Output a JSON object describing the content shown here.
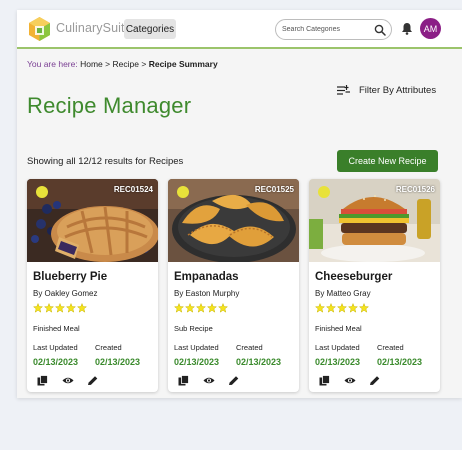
{
  "header": {
    "brand": "CulinarySuite",
    "nav_label": "Categories",
    "search_placeholder": "Search Categories",
    "avatar_initials": "AM"
  },
  "breadcrumb": {
    "prefix": "You are here:",
    "items": [
      "Home",
      "Recipe"
    ],
    "separator": ">",
    "current": "Recipe Summary"
  },
  "toolbar": {
    "filter_label": "Filter By Attributes",
    "create_label": "Create New Recipe"
  },
  "page": {
    "title": "Recipe Manager",
    "results_text": "Showing all 12/12 results for Recipes"
  },
  "labels": {
    "last_updated": "Last Updated",
    "created": "Created"
  },
  "colors": {
    "brand_green": "#3f8a2e",
    "button_green": "#3a7f2a",
    "date_green": "#3a8a2c",
    "avatar_bg": "#8b1f86",
    "star_yellow": "#f5e31e",
    "status_dot": "#e8e23a",
    "breadcrumb_prefix": "#7a3f93"
  },
  "recipes": [
    {
      "code": "REC01524",
      "title": "Blueberry Pie",
      "author": "By Oakley Gomez",
      "rating": 5,
      "type": "Finished Meal",
      "last_updated": "02/13/2023",
      "created": "02/13/2023",
      "image": "blueberry-pie-photo"
    },
    {
      "code": "REC01525",
      "title": "Empanadas",
      "author": "By Easton Murphy",
      "rating": 5,
      "type": "Sub Recipe",
      "last_updated": "02/13/2023",
      "created": "02/13/2023",
      "image": "empanadas-photo"
    },
    {
      "code": "REC01526",
      "title": "Cheeseburger",
      "author": "By Matteo Gray",
      "rating": 5,
      "type": "Finished Meal",
      "last_updated": "02/13/2023",
      "created": "02/13/2023",
      "image": "cheeseburger-photo"
    }
  ],
  "icons": {
    "copy": "copy-icon",
    "view": "eye-icon",
    "edit": "pencil-icon",
    "search": "search-icon",
    "notifications": "bell-icon",
    "filter": "filter-icon"
  }
}
